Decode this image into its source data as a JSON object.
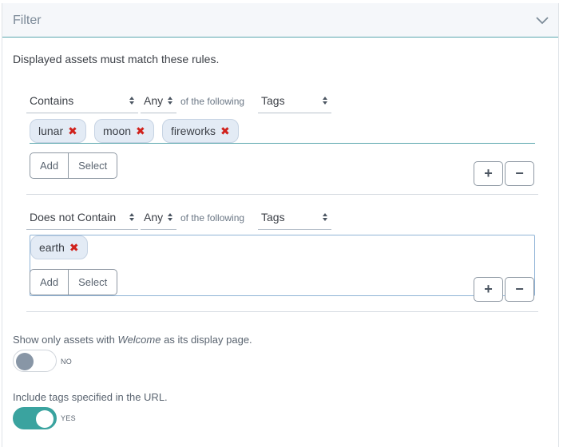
{
  "filter": {
    "title": "Filter",
    "intro": "Displayed assets must match these rules."
  },
  "rules": [
    {
      "condition": "Contains",
      "quantifier": "Any",
      "connector": "of the following",
      "field": "Tags",
      "tags": [
        "lunar",
        "moon",
        "fireworks"
      ],
      "add_label": "Add",
      "select_label": "Select",
      "plus_label": "+",
      "minus_label": "−"
    },
    {
      "condition": "Does not Contain",
      "quantifier": "Any",
      "connector": "of the following",
      "field": "Tags",
      "tags": [
        "earth"
      ],
      "add_label": "Add",
      "select_label": "Select",
      "plus_label": "+",
      "minus_label": "−"
    }
  ],
  "options": {
    "display_page": {
      "label_pre": "Show only assets with",
      "label_em": "Welcome",
      "label_post": " as its display page.",
      "state": "NO",
      "on": false
    },
    "url_tags": {
      "label": "Include tags specified in the URL.",
      "state": "YES",
      "on": true
    }
  },
  "colors": {
    "accent": "#3aa39f",
    "remove_x": "#d0211b",
    "tag_bg": "#e3ebf5"
  },
  "icons": {
    "collapse": "chevron-down-icon",
    "select_arrows": "sort-arrows-icon",
    "remove_tag": "remove-x-icon"
  }
}
